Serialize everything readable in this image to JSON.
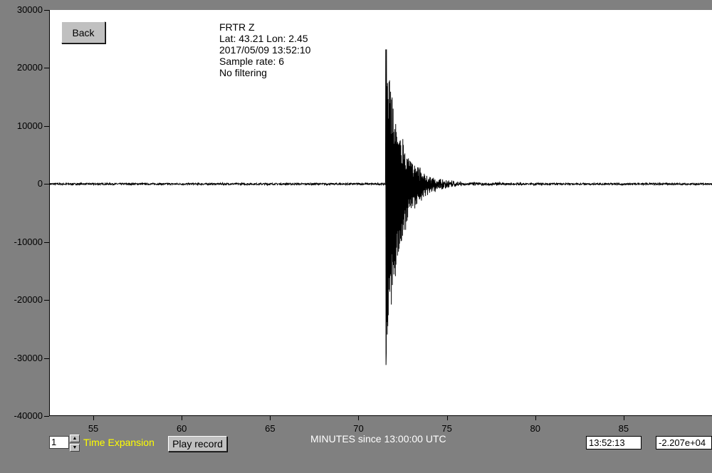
{
  "back_label": "Back",
  "info": {
    "station": "FRTR  Z",
    "location": "Lat: 43.21 Lon: 2.45",
    "datetime": "2017/05/09 13:52:10",
    "sample_rate": "Sample rate: 6",
    "filter": "No filtering"
  },
  "controls": {
    "time_expansion_value": "1",
    "time_expansion_label": "Time Expansion",
    "play_label": "Play record",
    "time_readout": "13:52:13",
    "value_readout": "-2.207e+04"
  },
  "colors": {
    "background": "#808080",
    "plot_bg": "#ffffff",
    "trace": "#000000",
    "label_yellow": "#ffff00"
  },
  "chart_data": {
    "type": "line",
    "xlabel": "MINUTES since 13:00:00 UTC",
    "ylabel": "",
    "xlim": [
      52.5,
      90
    ],
    "ylim": [
      -40000,
      30000
    ],
    "yticks": [
      "30000",
      "20000",
      "10000",
      "0",
      "-10000",
      "-20000",
      "-30000",
      "-40000"
    ],
    "ytick_values": [
      30000,
      20000,
      10000,
      0,
      -10000,
      -20000,
      -30000,
      -40000
    ],
    "xticks": [
      "55",
      "60",
      "65",
      "70",
      "75",
      "80",
      "85"
    ],
    "xtick_values": [
      55,
      60,
      65,
      70,
      75,
      80,
      85
    ],
    "event_onset": 71.5,
    "peak_max": 23200,
    "peak_min": -31200,
    "noise_level": 300,
    "grid": false
  }
}
